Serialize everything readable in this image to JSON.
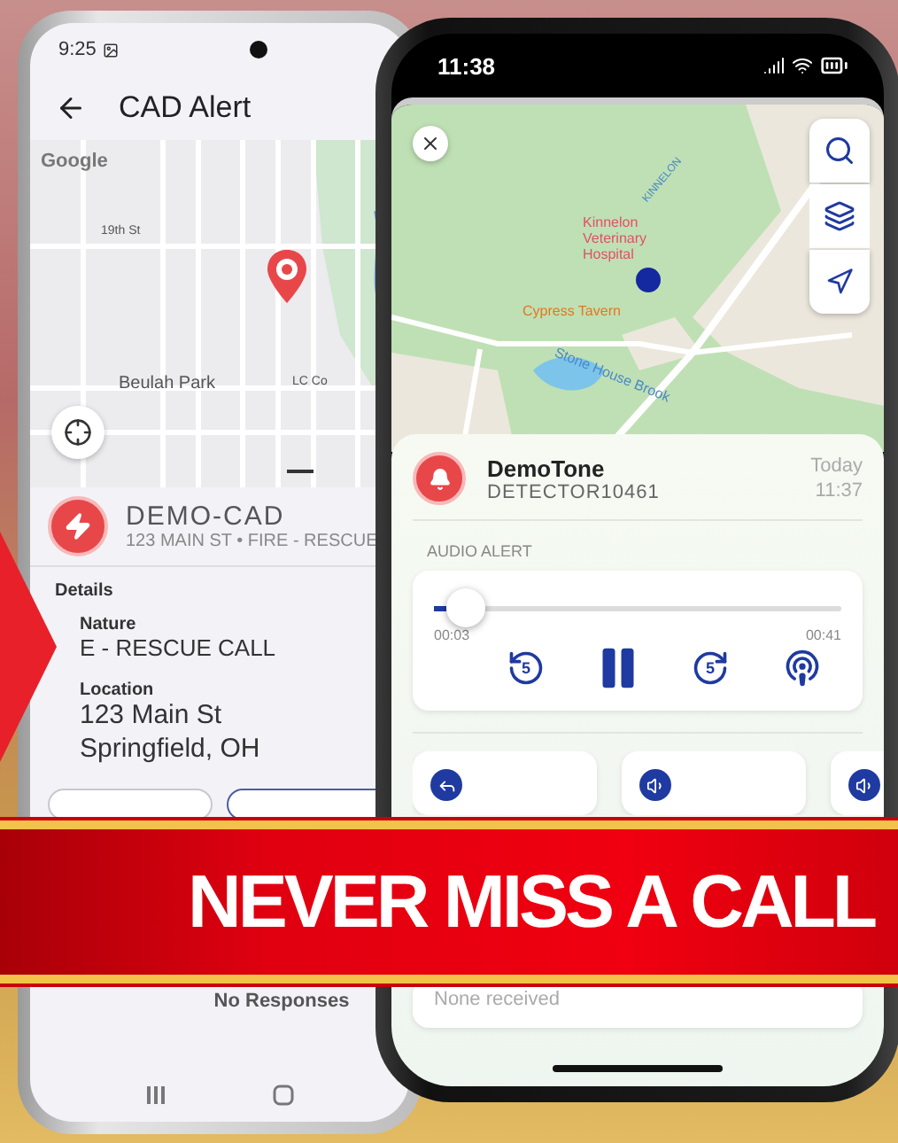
{
  "left_phone": {
    "status_bar": {
      "time": "9:25"
    },
    "app_bar": {
      "title": "CAD Alert"
    },
    "map": {
      "logo": "Google",
      "labels": [
        "19th St",
        "Beulah Park",
        "LC Co"
      ]
    },
    "incident": {
      "title": "DEMO-CAD",
      "subtitle": "123 MAIN ST • FIRE - RESCUE"
    },
    "details": {
      "heading": "Details",
      "fields": [
        {
          "label": "Nature",
          "value": "E - RESCUE CALL"
        },
        {
          "label": "Location",
          "value": "123 Main St\nSpringfield, OH"
        }
      ]
    },
    "responses": {
      "empty_text": "No Responses"
    }
  },
  "right_phone": {
    "status_bar": {
      "time": "11:38"
    },
    "map": {
      "labels": [
        "Kinnelon Veterinary Hospital",
        "Cypress Tavern",
        "Stone House Brook",
        "KINNELON"
      ]
    },
    "alert": {
      "title": "DemoTone",
      "subtitle": "DETECTOR10461",
      "day": "Today",
      "time": "11:37"
    },
    "audio": {
      "heading": "AUDIO ALERT",
      "level": 0.08,
      "elapsed": "00:03",
      "total": "00:41",
      "controls": [
        {
          "kind": "rewind",
          "label": "5"
        },
        {
          "kind": "pause"
        },
        {
          "kind": "forward",
          "label": "5"
        },
        {
          "kind": "cast"
        }
      ]
    },
    "actions": [
      {
        "kind": "reply"
      },
      {
        "kind": "speaker"
      },
      {
        "kind": "speaker"
      }
    ],
    "responses": {
      "empty_text": "None received"
    }
  },
  "banner": {
    "text": "NEVER MISS A CALL"
  }
}
